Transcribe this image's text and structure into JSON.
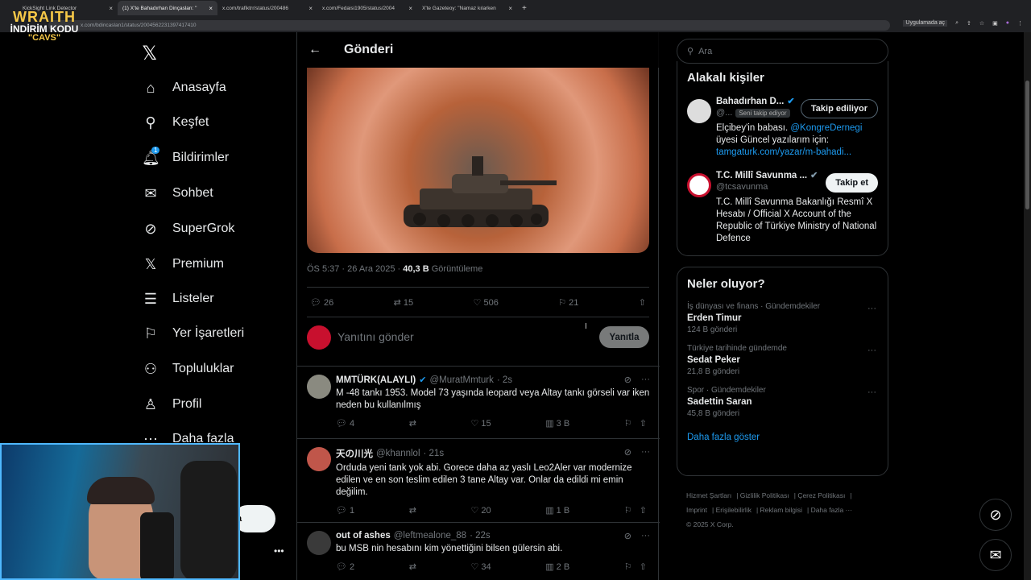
{
  "browser": {
    "tabs": [
      {
        "label": "KickSight Link Detector",
        "active": false
      },
      {
        "label": "(1) X'te Bahadırhan Dinçaslan: \"",
        "active": true
      },
      {
        "label": "x.com/trafiktrr/status/200486",
        "active": false
      },
      {
        "label": "x.com/Fedaisi1905/status/2004",
        "active": false
      },
      {
        "label": "X'te Gazeteoy: \"Namaz kılarken",
        "active": false
      }
    ],
    "url": "x.com/bdincaslan1/status/2004562231397417410",
    "open_in_app": "Uygulamada aç"
  },
  "overlay": {
    "line1": "WRAITH",
    "line2": "İNDİRİM KODU",
    "line3": "\"CAVS\""
  },
  "nav": {
    "items": [
      {
        "label": "Anasayfa",
        "icon": "home-icon"
      },
      {
        "label": "Keşfet",
        "icon": "search-icon"
      },
      {
        "label": "Bildirimler",
        "icon": "bell-icon",
        "badge": "1"
      },
      {
        "label": "Sohbet",
        "icon": "mail-icon"
      },
      {
        "label": "SuperGrok",
        "icon": "grok-icon"
      },
      {
        "label": "Premium",
        "icon": "x-icon"
      },
      {
        "label": "Listeler",
        "icon": "list-icon"
      },
      {
        "label": "Yer İşaretleri",
        "icon": "bookmark-icon"
      },
      {
        "label": "Topluluklar",
        "icon": "communities-icon"
      },
      {
        "label": "Profil",
        "icon": "profile-icon"
      },
      {
        "label": "Daha fazla",
        "icon": "more-icon"
      }
    ],
    "post_partial": "a"
  },
  "post": {
    "header_title": "Gönderi",
    "time": "ÖS 5:37 · 26 Ara 2025 · ",
    "views_value": "40,3 B",
    "views_label": " Görüntüleme",
    "replies": "26",
    "reposts": "15",
    "likes": "506",
    "bookmarks": "21",
    "reply_placeholder": "Yanıtını gönder",
    "reply_button": "Yanıtla"
  },
  "replies": [
    {
      "name": "MMTÜRK(ALAYLI)",
      "handle": "@MuratMmturk",
      "time": "· 2s",
      "verified": true,
      "text": "M -48 tankı 1953. Model 73 yaşında leopard veya Altay tankı görseli var iken neden bu kullanılmış",
      "replies": "4",
      "reposts": "",
      "likes": "15",
      "views": "3 B"
    },
    {
      "name": "天の川光",
      "handle": "@khannlol",
      "time": "· 21s",
      "verified": false,
      "text": "Orduda yeni tank yok abi. Gorece daha az yaslı Leo2Aler var modernize edilen ve en son teslim edilen 3 tane Altay var. Onlar da edildi mi emin değilim.",
      "replies": "1",
      "reposts": "",
      "likes": "20",
      "views": "1 B"
    },
    {
      "name": "out of ashes",
      "handle": "@leftmealone_88",
      "time": "· 22s",
      "verified": false,
      "text": "bu MSB nin hesabını kim yönettiğini bilsen gülersin abi.",
      "replies": "2",
      "reposts": "",
      "likes": "34",
      "views": "2 B"
    }
  ],
  "sidebar": {
    "search_placeholder": "Ara",
    "relevant_title": "Alakalı kişiler",
    "people": [
      {
        "name": "Bahadırhan D...",
        "handle": "@...",
        "follows_you": "Seni takip ediyor",
        "button": "Takip ediliyor",
        "bio_pre": "Elçibey'in babası. ",
        "bio_link1": "@KongreDernegi",
        "bio_mid": " üyesi Güncel yazılarım için: ",
        "bio_link2": "tamgaturk.com/yazar/m-bahadi..."
      },
      {
        "name": "T.C. Millî Savunma ...",
        "handle": "@tcsavunma",
        "button": "Takip et",
        "bio": "T.C. Millî Savunma Bakanlığı Resmî X Hesabı / Official X Account of the Republic of Türkiye Ministry of National Defence"
      }
    ],
    "trends_title": "Neler oluyor?",
    "trends": [
      {
        "category": "İş dünyası ve finans · Gündemdekiler",
        "name": "Erden Timur",
        "count": "124 B gönderi"
      },
      {
        "category": "Türkiye tarihinde gündemde",
        "name": "Sedat Peker",
        "count": "21,8 B gönderi"
      },
      {
        "category": "Spor · Gündemdekiler",
        "name": "Sadettin Saran",
        "count": "45,8 B gönderi"
      }
    ],
    "show_more": "Daha fazla göster",
    "footer": [
      "Hizmet Şartları",
      "Gizlilik Politikası",
      "Çerez Politikası",
      "Imprint",
      "Erişilebilirlik",
      "Reklam bilgisi",
      "Daha fazla ···",
      "© 2025 X Corp."
    ]
  },
  "colors": {
    "accent": "#1d9bf0",
    "border": "#2f3336",
    "muted": "#71767b"
  }
}
